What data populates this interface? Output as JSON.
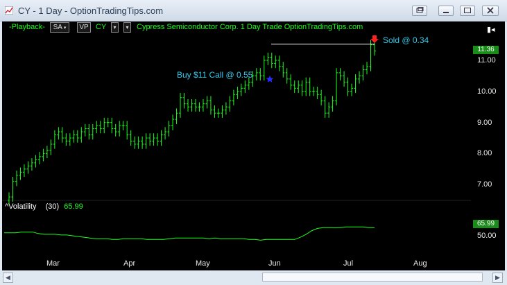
{
  "window": {
    "title": "CY - 1 Day - OptionTradingTips.com",
    "colors": {
      "chart_bg": "#000000",
      "bars": "#1cff1c",
      "annotation": "#33c8ea",
      "sell_marker": "#ff2020",
      "buy_marker": "#2a2aff"
    },
    "buttons": [
      "restore-icon",
      "minimize-icon",
      "maximize-icon",
      "close-icon"
    ]
  },
  "toolbar": {
    "playback": "-Playback-",
    "mode": "SA",
    "vp": "VP",
    "symbol": "CY",
    "description": "Cypress Semiconductor Corp.  1 Day  Trade  OptionTradingTips.com"
  },
  "annotations": {
    "buy": "Buy $11 Call @ 0.55",
    "sell": "Sold @ 0.34"
  },
  "indicator": {
    "name": "^Volatility",
    "period": "(30)",
    "value": "65.99"
  },
  "price_tags": {
    "last_price": "11.36",
    "last_vol": "65.99"
  },
  "chart_data": {
    "type": "bar",
    "price_axis": {
      "ticks": [
        "11.00",
        "10.00",
        "9.00",
        "8.00",
        "7.00"
      ],
      "range": [
        6.3,
        11.8
      ]
    },
    "volatility_axis": {
      "ticks": [
        "50.00"
      ]
    },
    "x_ticks": [
      "Mar",
      "Apr",
      "May",
      "Jun",
      "Jul",
      "Aug"
    ],
    "price_closes": [
      6.6,
      7.1,
      7.3,
      7.4,
      7.5,
      7.6,
      7.7,
      7.8,
      7.9,
      8.0,
      8.1,
      8.3,
      8.6,
      8.7,
      8.5,
      8.4,
      8.5,
      8.6,
      8.5,
      8.7,
      8.8,
      8.6,
      8.8,
      8.9,
      8.8,
      9.0,
      9.0,
      8.8,
      8.7,
      8.9,
      8.9,
      8.6,
      8.4,
      8.3,
      8.4,
      8.3,
      8.5,
      8.4,
      8.5,
      8.4,
      8.6,
      8.7,
      8.9,
      9.1,
      9.3,
      9.8,
      9.6,
      9.5,
      9.6,
      9.5,
      9.5,
      9.6,
      9.7,
      9.4,
      9.3,
      9.3,
      9.4,
      9.5,
      9.7,
      9.9,
      10.0,
      10.1,
      10.2,
      10.3,
      10.5,
      10.6,
      10.5,
      11.0,
      11.1,
      10.9,
      11.0,
      10.8,
      10.6,
      10.4,
      10.2,
      10.1,
      10.2,
      10.0,
      10.3,
      10.0,
      10.0,
      9.9,
      9.7,
      9.3,
      9.5,
      9.7,
      10.6,
      10.5,
      10.3,
      10.0,
      10.1,
      10.4,
      10.5,
      10.7,
      10.8,
      11.5,
      11.3
    ],
    "volatility": [
      54,
      54,
      54,
      55,
      55,
      55,
      53,
      52,
      52,
      52,
      51,
      51,
      50,
      49,
      48,
      47,
      46,
      46,
      46,
      45,
      45,
      46,
      46,
      46,
      46,
      45,
      45,
      45,
      45,
      46,
      47,
      47,
      47,
      47,
      47,
      47,
      46,
      47,
      46,
      46,
      46,
      46,
      46,
      45,
      45,
      44,
      45,
      45,
      45,
      45,
      45,
      45,
      48,
      52,
      57,
      60,
      61,
      61,
      61,
      61,
      62,
      62,
      62,
      62,
      61,
      61
    ],
    "buy_price": 10.4,
    "sell_price": 11.5,
    "sell_line_price": 11.5
  }
}
